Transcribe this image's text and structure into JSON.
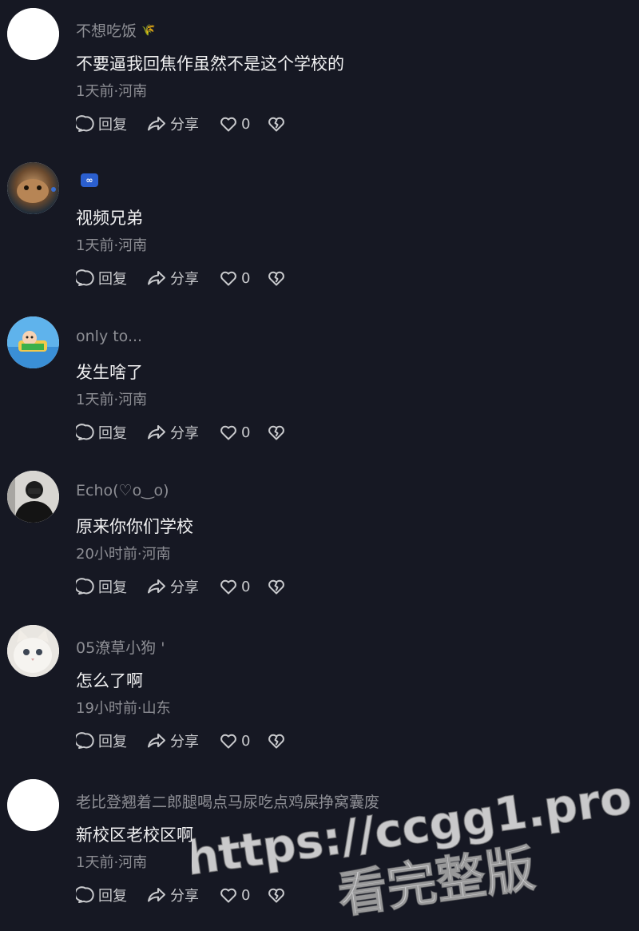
{
  "comments": [
    {
      "username": "不想吃饭",
      "badge": "🌾",
      "badge_color": "#7ec66b",
      "avatar": "blank",
      "text": "不要逼我回焦作虽然不是这个学校的",
      "meta": "1天前·河南",
      "actions": {
        "reply": "回复",
        "share": "分享",
        "likes": "0"
      }
    },
    {
      "username": "",
      "badge": "∞",
      "badge_color": "#2b5fcf",
      "avatar": "hamster",
      "text": "视频兄弟",
      "meta": "1天前·河南",
      "actions": {
        "reply": "回复",
        "share": "分享",
        "likes": "0"
      }
    },
    {
      "username": "only to...",
      "badge": "",
      "avatar": "cartoon",
      "text": "发生啥了",
      "meta": "1天前·河南",
      "actions": {
        "reply": "回复",
        "share": "分享",
        "likes": "0"
      }
    },
    {
      "username": "Echo(♡o‿o)",
      "badge": "",
      "avatar": "dark-figure",
      "text": "原来你你们学校",
      "meta": "20小时前·河南",
      "actions": {
        "reply": "回复",
        "share": "分享",
        "likes": "0"
      }
    },
    {
      "username": "05潦草小狗 '",
      "badge": "",
      "avatar": "white-cat",
      "text": "怎么了啊",
      "meta": "19小时前·山东",
      "actions": {
        "reply": "回复",
        "share": "分享",
        "likes": "0"
      }
    },
    {
      "username": "老比登翘着二郎腿喝点马尿吃点鸡屎挣窝囊废",
      "badge": "",
      "avatar": "blank",
      "text": "新校区老校区啊",
      "meta": "1天前·河南",
      "actions": {
        "reply": "回复",
        "share": "分享",
        "likes": "0"
      }
    }
  ],
  "watermark": {
    "url": "https://ccgg1.pro",
    "caption": "看完整版"
  },
  "colors": {
    "background": "#161823",
    "secondary_text": "#8d8e94",
    "primary_text": "#f1f1f2"
  },
  "icons": [
    "reply-icon",
    "share-icon",
    "heart-icon",
    "broken-heart-icon"
  ]
}
